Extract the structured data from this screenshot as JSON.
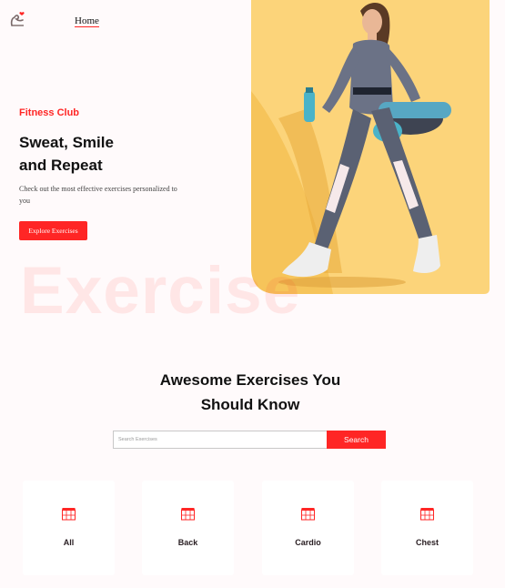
{
  "nav": {
    "home_label": "Home"
  },
  "hero": {
    "eyebrow": "Fitness Club",
    "title_line1": "Sweat, Smile",
    "title_line2": "and Repeat",
    "description": "Check out the most effective exercises personalized to you",
    "cta_label": "Explore Exercises",
    "watermark": "Exercise"
  },
  "exercises": {
    "title_line1": "Awesome Exercises You",
    "title_line2": "Should Know",
    "search_placeholder": "Search Exercises",
    "search_button": "Search"
  },
  "categories": [
    {
      "label": "All",
      "icon": "gym-icon"
    },
    {
      "label": "Back",
      "icon": "gym-icon"
    },
    {
      "label": "Cardio",
      "icon": "gym-icon"
    },
    {
      "label": "Chest",
      "icon": "gym-icon"
    }
  ],
  "colors": {
    "accent": "#ff2625",
    "hero_bg": "#fcd47a",
    "page_bg": "#fffafb"
  }
}
